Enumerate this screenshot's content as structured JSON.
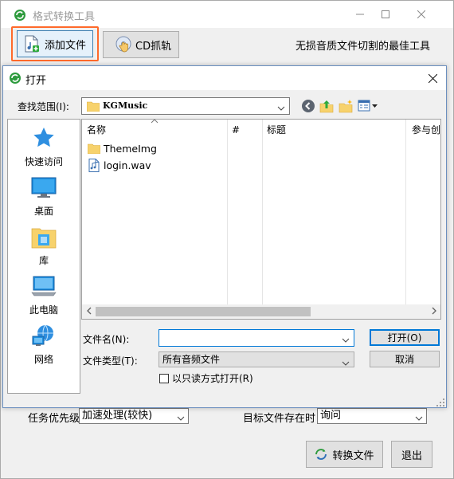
{
  "app": {
    "title": "格式转换工具",
    "toolbar": {
      "add_file": "添加文件",
      "cd_rip": "CD抓轨"
    },
    "slogan": "无损音质文件切割的最佳工具",
    "bottom": {
      "priority_label": "任务优先级",
      "priority_value": "加速处理(较快)",
      "exists_label": "目标文件存在时",
      "exists_value": "询问",
      "convert_button": "转换文件",
      "exit_button": "退出"
    }
  },
  "dialog": {
    "title": "打开",
    "look_in_label": "查找范围(I):",
    "look_in_value": "KGMusic",
    "places": [
      {
        "label": "快速访问",
        "icon": "star-icon"
      },
      {
        "label": "桌面",
        "icon": "desktop-icon"
      },
      {
        "label": "库",
        "icon": "library-icon"
      },
      {
        "label": "此电脑",
        "icon": "computer-icon"
      },
      {
        "label": "网络",
        "icon": "network-icon"
      }
    ],
    "columns": [
      "名称",
      "#",
      "标题",
      "参与创作"
    ],
    "files": [
      {
        "name": "ThemeImg",
        "icon": "folder-icon"
      },
      {
        "name": "login.wav",
        "icon": "audio-file-icon"
      }
    ],
    "file_name_label": "文件名(N):",
    "file_name_value": "",
    "file_type_label": "文件类型(T):",
    "file_type_value": "所有音频文件",
    "readonly_label": "以只读方式打开(R)",
    "open_button": "打开(O)",
    "cancel_button": "取消"
  },
  "colors": {
    "highlight_border": "#ff6a2b",
    "accent": "#0078d7",
    "folder": "#f7d26c"
  }
}
